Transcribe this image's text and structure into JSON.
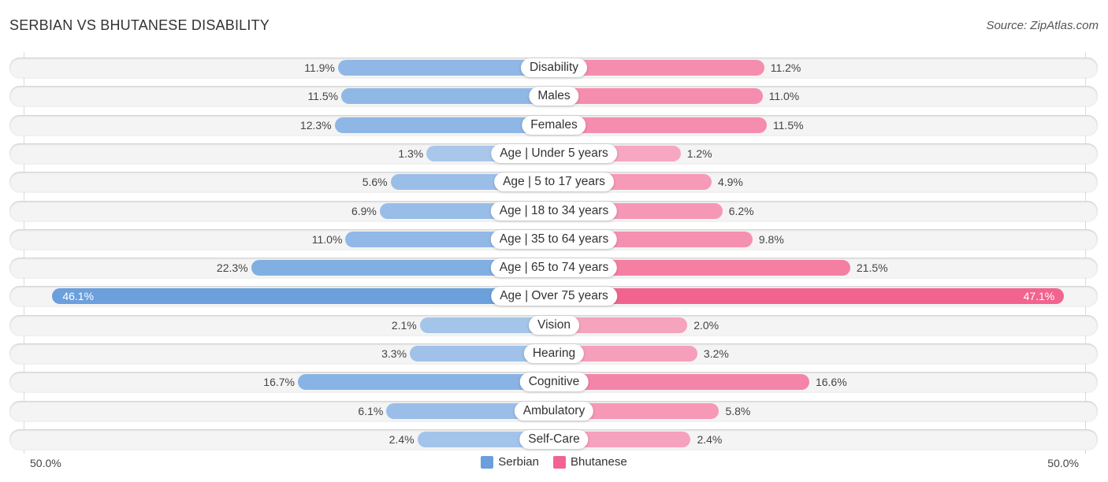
{
  "header": {
    "title": "SERBIAN VS BHUTANESE DISABILITY",
    "source": "Source: ZipAtlas.com"
  },
  "colors": {
    "serbian_strong": "#6a9fdc",
    "serbian_light": "#abc9ec",
    "bhutanese_strong": "#f2648f",
    "bhutanese_light": "#f7aac3"
  },
  "chart_data": {
    "type": "bar",
    "orientation": "horizontal-diverging",
    "title": "SERBIAN VS BHUTANESE DISABILITY",
    "categories": [
      "Disability",
      "Males",
      "Females",
      "Age | Under 5 years",
      "Age | 5 to 17 years",
      "Age | 18 to 34 years",
      "Age | 35 to 64 years",
      "Age | 65 to 74 years",
      "Age | Over 75 years",
      "Vision",
      "Hearing",
      "Cognitive",
      "Ambulatory",
      "Self-Care"
    ],
    "series": [
      {
        "name": "Serbian",
        "side": "left",
        "values": [
          11.9,
          11.5,
          12.3,
          1.3,
          5.6,
          6.9,
          11.0,
          22.3,
          46.1,
          2.1,
          3.3,
          16.7,
          6.1,
          2.4
        ],
        "labels": [
          "11.9%",
          "11.5%",
          "12.3%",
          "1.3%",
          "5.6%",
          "6.9%",
          "11.0%",
          "22.3%",
          "46.1%",
          "2.1%",
          "3.3%",
          "16.7%",
          "6.1%",
          "2.4%"
        ]
      },
      {
        "name": "Bhutanese",
        "side": "right",
        "values": [
          11.2,
          11.0,
          11.5,
          1.2,
          4.9,
          6.2,
          9.8,
          21.5,
          47.1,
          2.0,
          3.2,
          16.6,
          5.8,
          2.4
        ],
        "labels": [
          "11.2%",
          "11.0%",
          "11.5%",
          "1.2%",
          "4.9%",
          "6.2%",
          "9.8%",
          "21.5%",
          "47.1%",
          "2.0%",
          "3.2%",
          "16.6%",
          "5.8%",
          "2.4%"
        ]
      }
    ],
    "xlim": [
      0,
      50
    ],
    "axis_labels": {
      "left": "50.0%",
      "right": "50.0%"
    },
    "legend": {
      "position": "bottom-center",
      "entries": [
        "Serbian",
        "Bhutanese"
      ]
    },
    "grid": false
  }
}
